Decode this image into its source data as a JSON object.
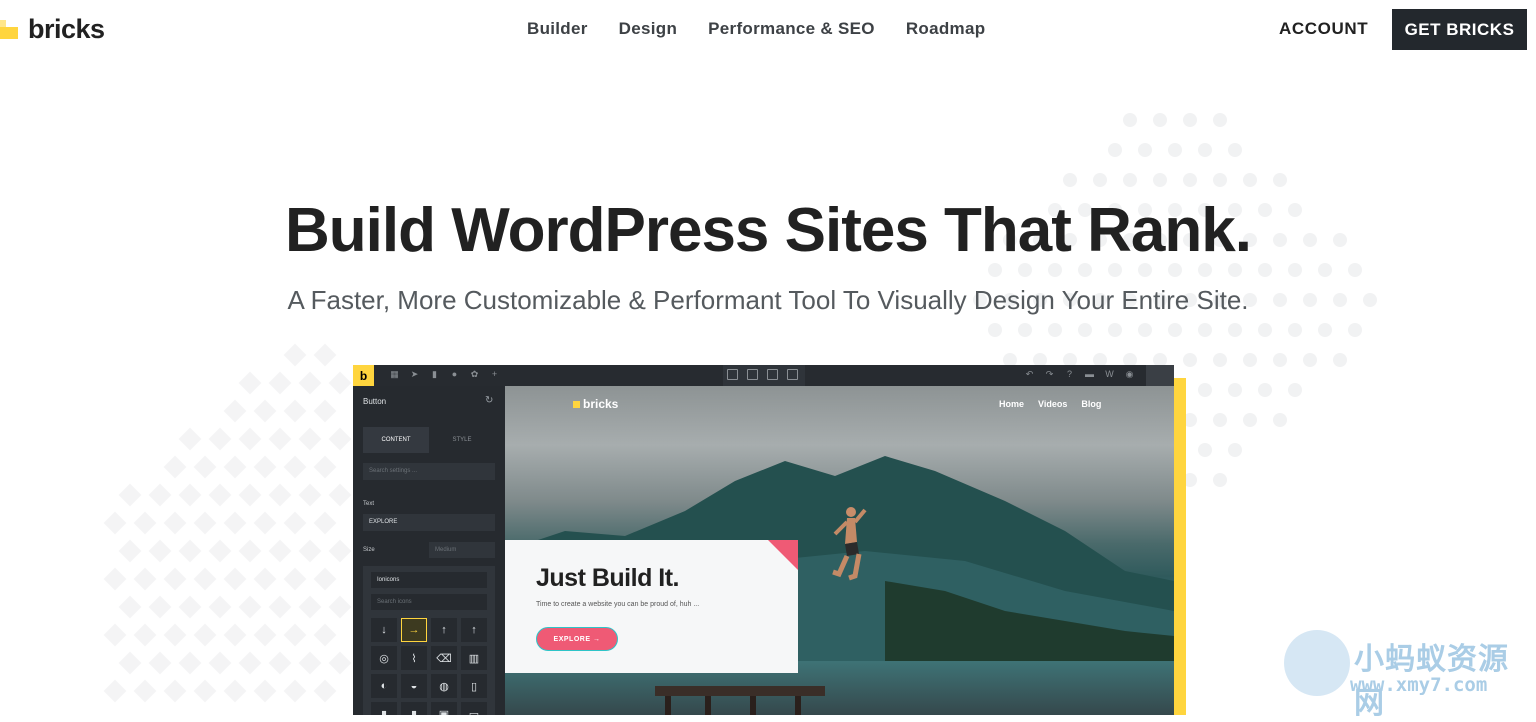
{
  "brand": {
    "name": "bricks",
    "accent": "#ffd53e"
  },
  "nav": {
    "items": [
      "Builder",
      "Design",
      "Performance & SEO",
      "Roadmap"
    ]
  },
  "header": {
    "account": "ACCOUNT",
    "cta": "GET BRICKS",
    "cta_bg": "#23282d"
  },
  "hero": {
    "title": "Build WordPress Sites That Rank.",
    "subtitle": "A Faster, More Customizable & Performant Tool To Visually Design Your Entire Site."
  },
  "builder": {
    "logo_letter": "b",
    "panel": {
      "title": "Button",
      "tab_content": "CONTENT",
      "tab_style": "STYLE",
      "search_placeholder": "Search settings ...",
      "text_label": "Text",
      "text_value": "EXPLORE",
      "size_label": "Size",
      "size_value": "Medium",
      "icon_library": "Ionicons",
      "icon_search_placeholder": "Search icons"
    },
    "preview": {
      "logo": "bricks",
      "nav": [
        "Home",
        "Videos",
        "Blog"
      ],
      "card_title": "Just Build It.",
      "card_sub": "Time to create a website you can be proud of, huh ...",
      "button": "EXPLORE",
      "button_color": "#ef5a75"
    }
  },
  "watermark": {
    "text": "小蚂蚁资源网",
    "url": "www.xmy7.com"
  }
}
